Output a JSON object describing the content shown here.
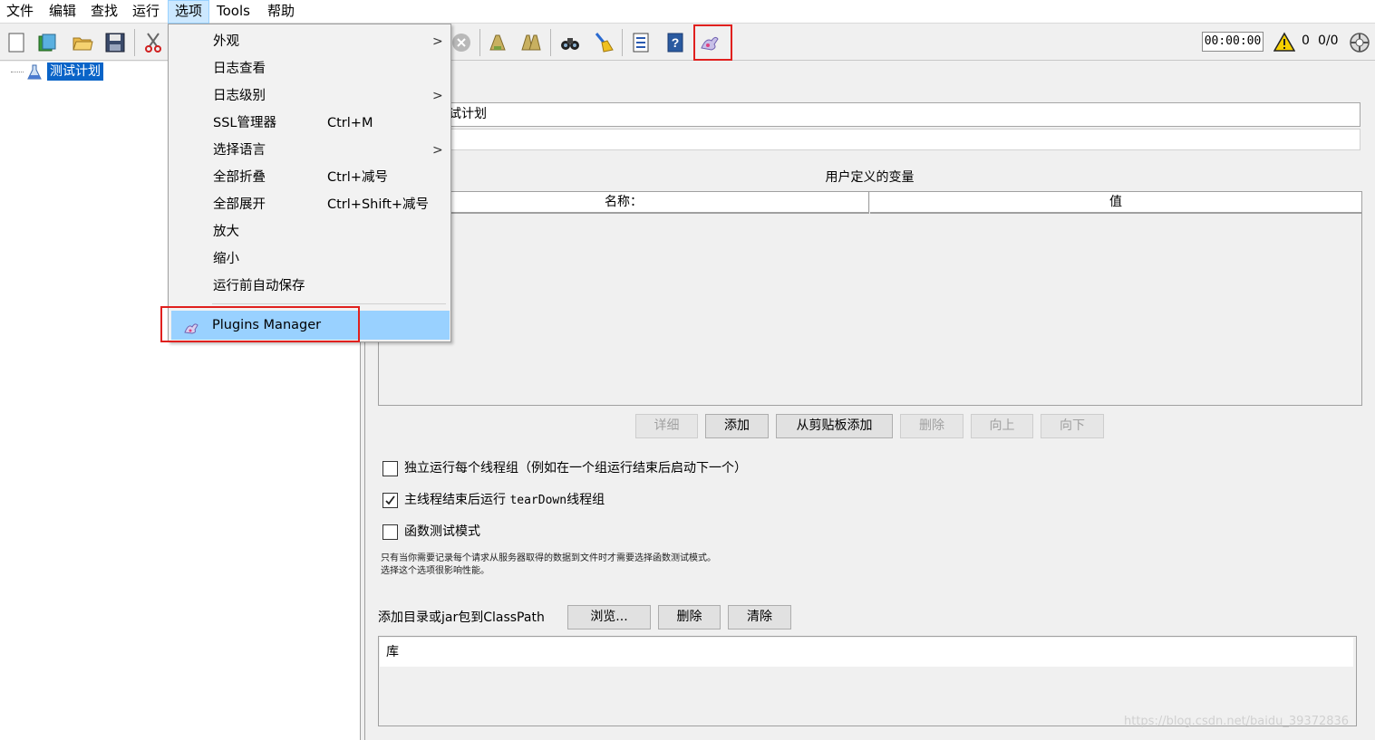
{
  "menubar": {
    "items": [
      {
        "label": "文件"
      },
      {
        "label": "编辑"
      },
      {
        "label": "查找"
      },
      {
        "label": "运行"
      },
      {
        "label": "选项",
        "active": true
      },
      {
        "label": "Tools"
      },
      {
        "label": "帮助"
      }
    ]
  },
  "toolbar": {
    "icons": [
      "new-icon",
      "templates-icon",
      "open-icon",
      "save-icon",
      "cut-icon",
      "stop-icon",
      "clear-icon",
      "clear-all-icon",
      "search-icon",
      "broom-icon",
      "function-helper-icon",
      "help-icon",
      "plugins-manager-icon"
    ],
    "timer": "00:00:00",
    "warning_count": "0",
    "threads": "0/0"
  },
  "tree": {
    "root_label": "测试计划"
  },
  "options_menu": {
    "items": [
      {
        "label": "外观",
        "shortcut": "",
        "submenu": true
      },
      {
        "label": "日志查看",
        "shortcut": "",
        "submenu": false
      },
      {
        "label": "日志级别",
        "shortcut": "",
        "submenu": true
      },
      {
        "label": "SSL管理器",
        "shortcut": "Ctrl+M",
        "submenu": false
      },
      {
        "label": "选择语言",
        "shortcut": "",
        "submenu": true
      },
      {
        "label": "全部折叠",
        "shortcut": "Ctrl+减号",
        "submenu": false
      },
      {
        "label": "全部展开",
        "shortcut": "Ctrl+Shift+减号",
        "submenu": false
      },
      {
        "label": "放大",
        "shortcut": "",
        "submenu": false
      },
      {
        "label": "缩小",
        "shortcut": "",
        "submenu": false
      },
      {
        "label": "运行前自动保存",
        "shortcut": "",
        "submenu": false
      }
    ],
    "plugins_manager": "Plugins Manager"
  },
  "test_plan": {
    "name_value": "试计划",
    "comment_value": "",
    "variables_title": "用户定义的变量",
    "columns": [
      "名称：",
      "值"
    ],
    "buttons": {
      "detail": "详细",
      "add": "添加",
      "add_clipboard": "从剪贴板添加",
      "delete": "删除",
      "up": "向上",
      "down": "向下"
    },
    "options": [
      {
        "label": "独立运行每个线程组（例如在一个组运行结束后启动下一个）",
        "checked": false
      },
      {
        "label_prefix": "主线程结束后运行 ",
        "label_mono": "tearDown",
        "label_suffix": "线程组",
        "checked": true
      },
      {
        "label": "函数测试模式",
        "checked": false
      }
    ],
    "note_lines": [
      "只有当你需要记录每个请求从服务器取得的数据到文件时才需要选择函数测试模式。",
      "选择这个选项很影响性能。"
    ],
    "classpath_label": "添加目录或jar包到ClassPath",
    "classpath_buttons": {
      "browse": "浏览...",
      "delete": "删除",
      "clear": "清除"
    },
    "library_header": "库"
  },
  "watermark": "https://blog.csdn.net/baidu_39372836"
}
